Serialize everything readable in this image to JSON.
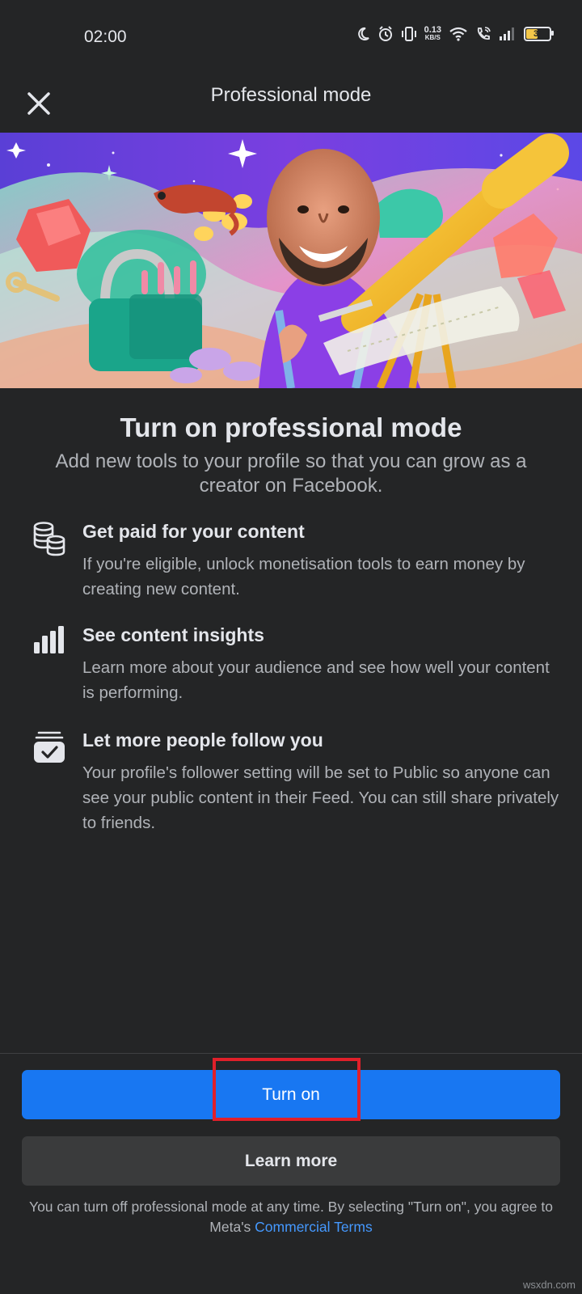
{
  "status_bar": {
    "time": "02:00",
    "net_speed_value": "0.13",
    "net_speed_unit": "KB/S",
    "battery_level": "31",
    "icons": [
      "moon-icon",
      "alarm-icon",
      "vibrate-icon",
      "wifi-icon",
      "wifi-calling-icon",
      "signal-icon",
      "battery-icon"
    ]
  },
  "header": {
    "title": "Professional mode",
    "close_icon": "close-icon"
  },
  "hero": {
    "description_icon": "hero-illustration"
  },
  "main": {
    "title": "Turn on professional mode",
    "subtitle": "Add new tools to your profile so that you can grow as a creator on Facebook."
  },
  "features": [
    {
      "icon": "coins-stack-icon",
      "title": "Get paid for your content",
      "description": "If you're eligible, unlock monetisation tools to earn money by creating new content."
    },
    {
      "icon": "bar-chart-icon",
      "title": "See content insights",
      "description": "Learn more about your audience and see how well your content is performing."
    },
    {
      "icon": "follow-check-icon",
      "title": "Let more people follow you",
      "description": "Your profile's follower setting will be set to Public so anyone can see your public content in their Feed. You can still share privately to friends."
    }
  ],
  "actions": {
    "turn_on_label": "Turn on",
    "learn_more_label": "Learn more"
  },
  "legal": {
    "text": "You can turn off professional mode at any time. By selecting \"Turn on\", you agree to Meta's",
    "link_text": "Commercial Terms"
  },
  "watermark": "wsxdn.com",
  "colors": {
    "background": "#242526",
    "primary": "#1877f2",
    "secondary_button": "#3a3b3c",
    "link": "#4599ff",
    "highlight": "#e0202a"
  }
}
